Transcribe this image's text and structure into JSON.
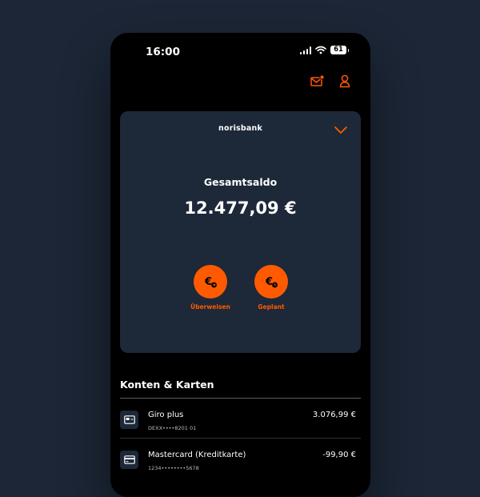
{
  "status_bar": {
    "time": "16:00",
    "battery": "61"
  },
  "card": {
    "brand": "norisbank",
    "balance_label": "Gesamtsaldo",
    "balance_value": "12.477,09 €",
    "actions": [
      {
        "label": "Überweisen",
        "icon": "euro-send-icon"
      },
      {
        "label": "Geplant",
        "icon": "euro-clock-icon"
      }
    ]
  },
  "accounts": {
    "title": "Konten & Karten",
    "items": [
      {
        "name": "Giro plus",
        "iban": "DEXX••••8201 01",
        "amount": "3.076,99 €",
        "icon": "account-card-icon"
      },
      {
        "name": "Mastercard (Kreditkarte)",
        "iban": "1234••••••••5678",
        "amount": "-99,90 €",
        "icon": "credit-card-icon"
      }
    ]
  },
  "colors": {
    "accent": "#ff5a00",
    "card_bg": "#1d2838",
    "page_bg": "#1c2636",
    "phone_bg": "#000000"
  }
}
